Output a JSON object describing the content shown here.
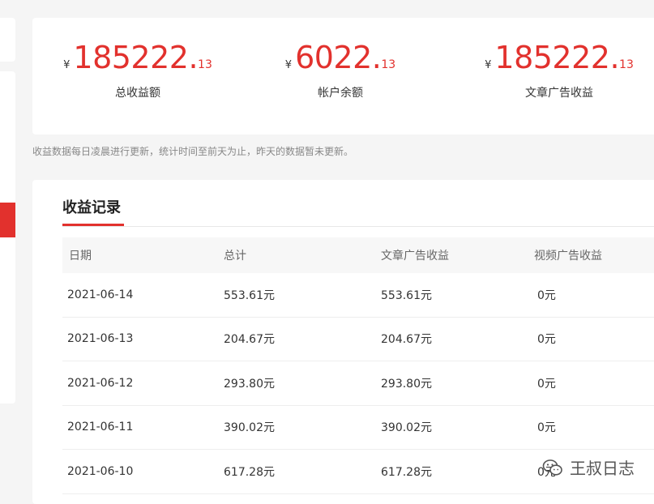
{
  "stats": [
    {
      "currency": "¥",
      "integer": "185222.",
      "decimal": "13",
      "label": "总收益额"
    },
    {
      "currency": "¥",
      "integer": "6022.",
      "decimal": "13",
      "label": "帐户余额"
    },
    {
      "currency": "¥",
      "integer": "185222.",
      "decimal": "13",
      "label": "文章广告收益"
    }
  ],
  "notice": "收益数据每日凌晨进行更新，统计时间至前天为止，昨天的数据暂未更新。",
  "records": {
    "title": "收益记录",
    "columns": [
      "日期",
      "总计",
      "文章广告收益",
      "视频广告收益"
    ],
    "rows": [
      [
        "2021-06-14",
        "553.61元",
        "553.61元",
        "0元"
      ],
      [
        "2021-06-13",
        "204.67元",
        "204.67元",
        "0元"
      ],
      [
        "2021-06-12",
        "293.80元",
        "293.80元",
        "0元"
      ],
      [
        "2021-06-11",
        "390.02元",
        "390.02元",
        "0元"
      ],
      [
        "2021-06-10",
        "617.28元",
        "617.28元",
        "0元"
      ]
    ]
  },
  "watermark": {
    "text": "王叔日志",
    "icon": "wechat-icon"
  },
  "colors": {
    "accent": "#e2312d",
    "muted": "#888888"
  }
}
